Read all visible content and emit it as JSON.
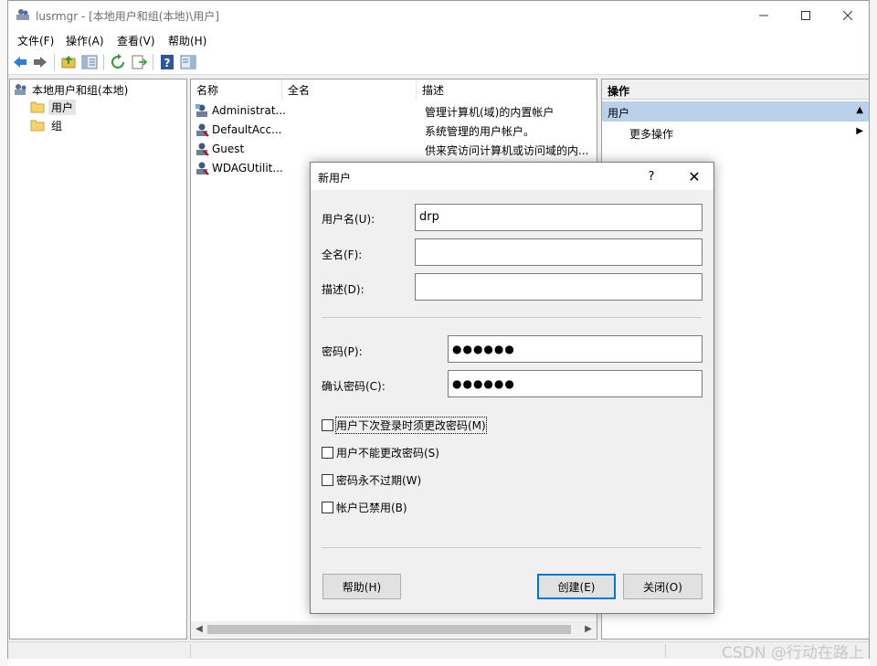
{
  "window": {
    "title": "lusrmgr - [本地用户和组(本地)\\用户]",
    "minimize_icon": "minimize-icon",
    "maximize_icon": "maximize-icon",
    "close_icon": "close-icon"
  },
  "menu": [
    {
      "label": "文件(F)"
    },
    {
      "label": "操作(A)"
    },
    {
      "label": "查看(V)"
    },
    {
      "label": "帮助(H)"
    }
  ],
  "toolbar": {
    "icons": [
      "back-arrow-icon",
      "forward-arrow-icon",
      "up-folder-icon",
      "show-hide-tree-icon",
      "refresh-icon",
      "export-list-icon",
      "help-icon",
      "show-hide-action-pane-icon"
    ]
  },
  "tree": {
    "root": "本地用户和组(本地)",
    "items": [
      {
        "label": "用户",
        "selected": true
      },
      {
        "label": "组",
        "selected": false
      }
    ]
  },
  "list": {
    "columns": [
      "名称",
      "全名",
      "描述"
    ],
    "rows": [
      {
        "name": "Administrat...",
        "full_name": "",
        "description": "管理计算机(域)的内置帐户"
      },
      {
        "name": "DefaultAcc...",
        "full_name": "",
        "description": "系统管理的用户帐户。"
      },
      {
        "name": "Guest",
        "full_name": "",
        "description": "供来宾访问计算机或访问域的内..."
      },
      {
        "name": "WDAGUtilit...",
        "full_name": "",
        "description": ""
      }
    ]
  },
  "actions": {
    "title": "操作",
    "section": "用户",
    "items": [
      {
        "label": "更多操作"
      }
    ]
  },
  "dialog": {
    "title": "新用户",
    "help_symbol": "?",
    "close_symbol": "✕",
    "username": {
      "label": "用户名(U):",
      "value": "drp"
    },
    "fullname": {
      "label": "全名(F):",
      "value": ""
    },
    "description": {
      "label": "描述(D):",
      "value": ""
    },
    "password": {
      "label": "密码(P):",
      "value": "●●●●●●"
    },
    "confirm_password": {
      "label": "确认密码(C):",
      "value": "●●●●●●"
    },
    "checkboxes": [
      {
        "label": "用户下次登录时须更改密码(M)",
        "checked": false
      },
      {
        "label": "用户不能更改密码(S)",
        "checked": false
      },
      {
        "label": "密码永不过期(W)",
        "checked": false
      },
      {
        "label": "帐户已禁用(B)",
        "checked": false
      }
    ],
    "buttons": {
      "help": "帮助(H)",
      "create": "创建(E)",
      "close": "关闭(O)"
    }
  },
  "watermark": "CSDN @行动在路上",
  "colors": {
    "accent": "#0078d7",
    "action_section_bg": "#b9d1ea",
    "window_bg": "#f0f0f0"
  }
}
